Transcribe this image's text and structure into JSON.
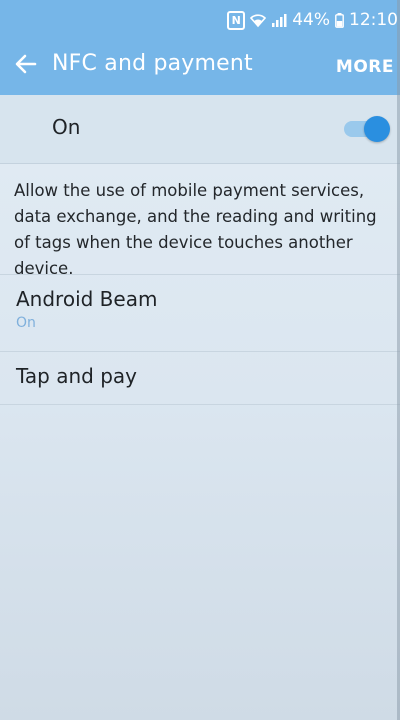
{
  "status_bar": {
    "nfc_label": "N",
    "battery_text": "44%",
    "time": "12:10",
    "icons": [
      "nfc-icon",
      "wifi-icon",
      "signal-icon",
      "battery-icon"
    ]
  },
  "app_bar": {
    "title": "NFC and payment",
    "more_label": "MORE",
    "back_icon": "back-arrow-icon",
    "color": "#76b6e8"
  },
  "master_switch": {
    "label": "On",
    "state": true,
    "accent": "#2a8fe0"
  },
  "description": "Allow the use of mobile payment services, data exchange, and the reading and writing of tags when the device touches another device.",
  "items": [
    {
      "title": "Android Beam",
      "subtitle": "On"
    },
    {
      "title": "Tap and pay"
    }
  ]
}
